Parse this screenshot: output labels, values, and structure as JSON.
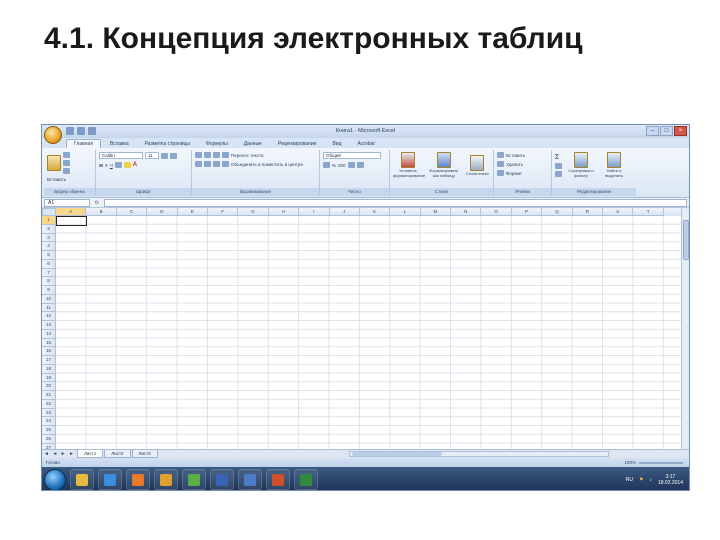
{
  "slide": {
    "title": "4.1. Концепция электронных таблиц"
  },
  "window": {
    "title": "Книга1 - Microsoft Excel"
  },
  "ribbon_tabs": [
    "Главная",
    "Вставка",
    "Разметка страницы",
    "Формулы",
    "Данные",
    "Рецензирование",
    "Вид",
    "Acrobat"
  ],
  "ribbon": {
    "clipboard": {
      "paste": "Вставить",
      "label": "Буфер обмена"
    },
    "font": {
      "name": "Calibri",
      "size": "11",
      "label": "Шрифт"
    },
    "alignment": {
      "wrap": "Перенос текста",
      "merge": "Объединить и поместить в центре",
      "label": "Выравнивание"
    },
    "number": {
      "format": "Общий",
      "label": "Число"
    },
    "styles": {
      "conditional": "Условное форматирование",
      "as_table": "Форматировать как таблицу",
      "cell_styles": "Стили ячеек",
      "label": "Стили"
    },
    "cells": {
      "insert": "Вставить",
      "delete": "Удалить",
      "format": "Формат",
      "label": "Ячейки"
    },
    "editing": {
      "sort": "Сортировка и фильтр",
      "find": "Найти и выделить",
      "label": "Редактирование"
    }
  },
  "formula_bar": {
    "cell_ref": "A1",
    "fx": "fx"
  },
  "grid": {
    "columns": [
      "A",
      "B",
      "C",
      "D",
      "E",
      "F",
      "G",
      "H",
      "I",
      "J",
      "K",
      "L",
      "M",
      "N",
      "O",
      "P",
      "Q",
      "R",
      "S",
      "T"
    ],
    "rows": [
      "1",
      "2",
      "3",
      "4",
      "5",
      "6",
      "7",
      "8",
      "9",
      "10",
      "11",
      "12",
      "13",
      "14",
      "15",
      "16",
      "17",
      "18",
      "19",
      "20",
      "21",
      "22",
      "23",
      "24",
      "25",
      "26",
      "27"
    ]
  },
  "sheets": {
    "nav": "◄ ◄ ► ►",
    "tabs": [
      "Лист1",
      "Лист2",
      "Лист3"
    ]
  },
  "status": {
    "text": "Готово",
    "zoom": "100%"
  },
  "taskbar": {
    "lang": "RU",
    "time": "3:17",
    "date": "18.02.2014",
    "apps": [
      {
        "name": "explorer",
        "color": "#e6b941"
      },
      {
        "name": "ie",
        "color": "#3b8ee0"
      },
      {
        "name": "media",
        "color": "#e87b2a"
      },
      {
        "name": "paint",
        "color": "#e0a030"
      },
      {
        "name": "chrome",
        "color": "#5ab046"
      },
      {
        "name": "word",
        "color": "#3a63b8"
      },
      {
        "name": "outlook",
        "color": "#4c7bc8"
      },
      {
        "name": "powerpoint",
        "color": "#d0502c"
      },
      {
        "name": "excel",
        "color": "#2f8a3e"
      }
    ]
  },
  "colors": {
    "accent": "#6f8fb8",
    "selection": "#f8d78a"
  }
}
